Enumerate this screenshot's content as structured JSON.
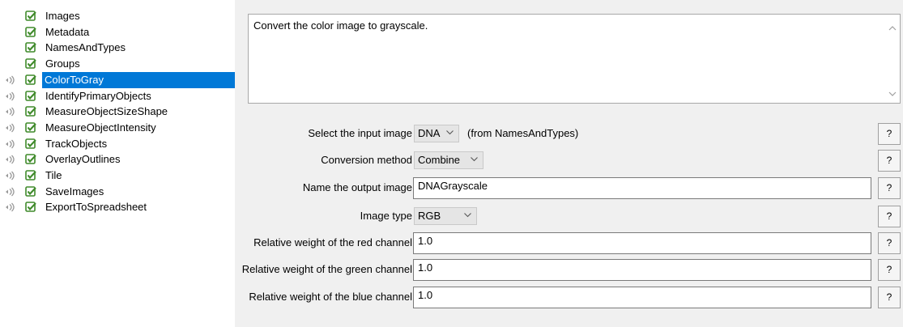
{
  "pipeline": {
    "modules": [
      {
        "label": "Images",
        "selected": false,
        "has_eye": false
      },
      {
        "label": "Metadata",
        "selected": false,
        "has_eye": false
      },
      {
        "label": "NamesAndTypes",
        "selected": false,
        "has_eye": false
      },
      {
        "label": "Groups",
        "selected": false,
        "has_eye": false
      },
      {
        "label": "ColorToGray",
        "selected": true,
        "has_eye": true
      },
      {
        "label": "IdentifyPrimaryObjects",
        "selected": false,
        "has_eye": true
      },
      {
        "label": "MeasureObjectSizeShape",
        "selected": false,
        "has_eye": true
      },
      {
        "label": "MeasureObjectIntensity",
        "selected": false,
        "has_eye": true
      },
      {
        "label": "TrackObjects",
        "selected": false,
        "has_eye": true
      },
      {
        "label": "OverlayOutlines",
        "selected": false,
        "has_eye": true
      },
      {
        "label": "Tile",
        "selected": false,
        "has_eye": true
      },
      {
        "label": "SaveImages",
        "selected": false,
        "has_eye": true
      },
      {
        "label": "ExportToSpreadsheet",
        "selected": false,
        "has_eye": true
      }
    ]
  },
  "settings": {
    "notes": "Convert the color image to grayscale.",
    "input_image": {
      "label": "Select the input image",
      "value": "DNA",
      "hint": "(from NamesAndTypes)"
    },
    "conversion": {
      "label": "Conversion method",
      "value": "Combine"
    },
    "output_name": {
      "label": "Name the output image",
      "value": "DNAGrayscale"
    },
    "image_type": {
      "label": "Image type",
      "value": "RGB"
    },
    "red_weight": {
      "label": "Relative weight of the red channel",
      "value": "1.0"
    },
    "green_weight": {
      "label": "Relative weight of the green channel",
      "value": "1.0"
    },
    "blue_weight": {
      "label": "Relative weight of the blue channel",
      "value": "1.0"
    },
    "help_label": "?"
  },
  "colors": {
    "selection": "#0078d7",
    "check": "#3f8a2a",
    "panel": "#f0f0f0"
  }
}
